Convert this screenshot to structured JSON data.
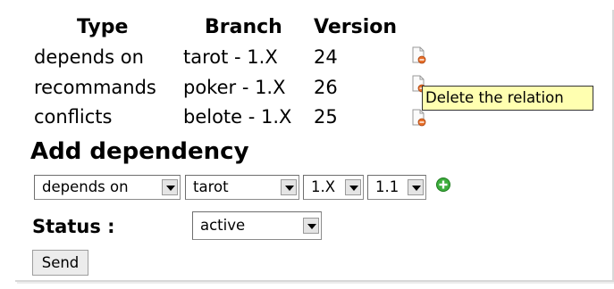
{
  "table": {
    "headers": {
      "type": "Type",
      "branch": "Branch",
      "version": "Version"
    },
    "rows": [
      {
        "type": "depends on",
        "branch": "tarot - 1.X",
        "version": "24"
      },
      {
        "type": "recommands",
        "branch": "poker - 1.X",
        "version": "26"
      },
      {
        "type": "conflicts",
        "branch": "belote - 1.X",
        "version": "25"
      }
    ],
    "delete_tooltip": "Delete the relation"
  },
  "add": {
    "heading": "Add dependency",
    "relation_select": "depends on",
    "project_select": "tarot",
    "branch_select": "1.X",
    "version_select": "1.1",
    "add_icon": "plus-circle-icon"
  },
  "status": {
    "label": "Status :",
    "select": "active"
  },
  "send_label": "Send",
  "colors": {
    "tooltip_bg": "#ffffb0",
    "delete_badge": "#e8702a",
    "add_icon": "#3cad3c"
  }
}
